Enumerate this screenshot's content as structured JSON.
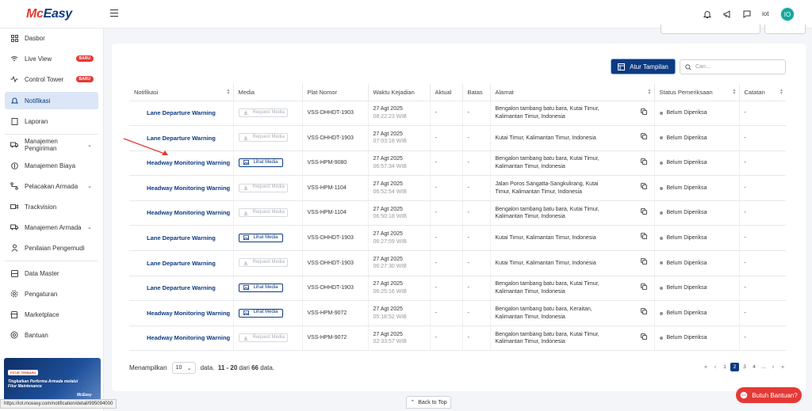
{
  "brand": {
    "logo_left": "Mc",
    "logo_right": "Easy"
  },
  "header": {
    "user_label": "iot",
    "avatar_initials": "IO"
  },
  "sidebar": {
    "items": [
      {
        "label": "Dasbor"
      },
      {
        "label": "Live View",
        "badge": "BARU"
      },
      {
        "label": "Control Tower",
        "badge": "BARU"
      },
      {
        "label": "Notifikasi"
      },
      {
        "label": "Laporan"
      },
      {
        "label": "Manajemen Pengiriman"
      },
      {
        "label": "Manajemen Biaya"
      },
      {
        "label": "Pelacakan Armada"
      },
      {
        "label": "Trackvision"
      },
      {
        "label": "Manajemen Armada"
      },
      {
        "label": "Penilaian Pengemudi"
      },
      {
        "label": "Data Master"
      },
      {
        "label": "Pengaturan"
      },
      {
        "label": "Marketplace"
      },
      {
        "label": "Bantuan"
      }
    ],
    "promo": {
      "tag": "FITUR TERBARU",
      "text": "Tingkatkan Performa Armada melalui Fitur Maintenance",
      "brand": "McEasy"
    }
  },
  "status_url": "https://iot.mceasy.com/notification/detail/995094000",
  "toolbar": {
    "atur_label": "Atur Tampilan",
    "search_placeholder": "Cari..."
  },
  "table": {
    "columns": [
      "Notifikasi",
      "Media",
      "Plat Nomor",
      "Waktu Kejadian",
      "Aktual",
      "Batas",
      "Alamat",
      "Status Pemeriksaan",
      "Catatan"
    ],
    "rows": [
      {
        "notif": "Lane Departure Warning",
        "media": "Request Media",
        "media_active": false,
        "plate": "VSS-DHHDT-1903",
        "date": "27 Agt 2025",
        "time": "08:22:23 WIB",
        "aktual": "-",
        "batas": "-",
        "addr1": "Bengalon tambang batu bara, Kutai Timur,",
        "addr2": "Kalimantan Timur, Indonesia",
        "status": "Belum Diperiksa",
        "catatan": "-"
      },
      {
        "notif": "Lane Departure Warning",
        "media": "Request Media",
        "media_active": false,
        "plate": "VSS-DHHDT-1903",
        "date": "27 Agt 2025",
        "time": "07:03:18 WIB",
        "aktual": "-",
        "batas": "-",
        "addr1": "Kutai Timur, Kalimantan Timur, Indonesia",
        "addr2": "",
        "status": "Belum Diperiksa",
        "catatan": "-"
      },
      {
        "notif": "Headway Monitoring Warning",
        "media": "Lihat Media",
        "media_active": true,
        "plate": "VSS-HPM-9080",
        "date": "27 Agt 2025",
        "time": "06:57:34 WIB",
        "aktual": "-",
        "batas": "-",
        "addr1": "Bengalon tambang batu bara, Kutai Timur,",
        "addr2": "Kalimantan Timur, Indonesia",
        "status": "Belum Diperiksa",
        "catatan": "-"
      },
      {
        "notif": "Headway Monitoring Warning",
        "media": "Request Media",
        "media_active": false,
        "plate": "VSS-HPM-1104",
        "date": "27 Agt 2025",
        "time": "06:52:54 WIB",
        "aktual": "-",
        "batas": "-",
        "addr1": "Jalan Poros Sangatta-Sangkulirang, Kutai",
        "addr2": "Timur, Kalimantan Timur, Indonesia",
        "status": "Belum Diperiksa",
        "catatan": "-"
      },
      {
        "notif": "Headway Monitoring Warning",
        "media": "Request Media",
        "media_active": false,
        "plate": "VSS-HPM-1104",
        "date": "27 Agt 2025",
        "time": "06:50:18 WIB",
        "aktual": "-",
        "batas": "-",
        "addr1": "Bengalon tambang batu bara, Kutai Timur,",
        "addr2": "Kalimantan Timur, Indonesia",
        "status": "Belum Diperiksa",
        "catatan": "-"
      },
      {
        "notif": "Lane Departure Warning",
        "media": "Lihat Media",
        "media_active": true,
        "plate": "VSS-DHHDT-1903",
        "date": "27 Agt 2025",
        "time": "06:27:59 WIB",
        "aktual": "-",
        "batas": "-",
        "addr1": "Kutai Timur, Kalimantan Timur, Indonesia",
        "addr2": "",
        "status": "Belum Diperiksa",
        "catatan": "-"
      },
      {
        "notif": "Lane Departure Warning",
        "media": "Request Media",
        "media_active": false,
        "plate": "VSS-DHHDT-1903",
        "date": "27 Agt 2025",
        "time": "06:27:30 WIB",
        "aktual": "-",
        "batas": "-",
        "addr1": "Kutai Timur, Kalimantan Timur, Indonesia",
        "addr2": "",
        "status": "Belum Diperiksa",
        "catatan": "-"
      },
      {
        "notif": "Lane Departure Warning",
        "media": "Lihat Media",
        "media_active": true,
        "plate": "VSS-DHHDT-1903",
        "date": "27 Agt 2025",
        "time": "06:25:16 WIB",
        "aktual": "-",
        "batas": "-",
        "addr1": "Bengalon tambang batu bara, Kutai Timur,",
        "addr2": "Kalimantan Timur, Indonesia",
        "status": "Belum Diperiksa",
        "catatan": "-"
      },
      {
        "notif": "Headway Monitoring Warning",
        "media": "Lihat Media",
        "media_active": true,
        "plate": "VSS-HPM-9072",
        "date": "27 Agt 2025",
        "time": "05:18:52 WIB",
        "aktual": "-",
        "batas": "-",
        "addr1": "Bengalon tambang batu bara, Keraitan,",
        "addr2": "Kalimantan Timur, Indonesia",
        "status": "Belum Diperiksa",
        "catatan": "-"
      },
      {
        "notif": "Headway Monitoring Warning",
        "media": "Request Media",
        "media_active": false,
        "plate": "VSS-HPM-9072",
        "date": "27 Agt 2025",
        "time": "02:33:57 WIB",
        "aktual": "-",
        "batas": "-",
        "addr1": "Bengalon tambang batu bara, Kutai Timur,",
        "addr2": "Kalimantan Timur, Indonesia",
        "status": "Belum Diperiksa",
        "catatan": "-"
      }
    ]
  },
  "pagination": {
    "show_label": "Menampilkan",
    "per_page": "10",
    "data_label": "data.",
    "range": "11 - 20",
    "of_label": "dari",
    "total": "66",
    "total_suffix": "data.",
    "pages": [
      "«",
      "‹",
      "1",
      "2",
      "3",
      "4",
      "...",
      "›",
      "»"
    ],
    "current": "2"
  },
  "back_to_top": "Back to Top",
  "help_button": "Butuh Bantuan?"
}
